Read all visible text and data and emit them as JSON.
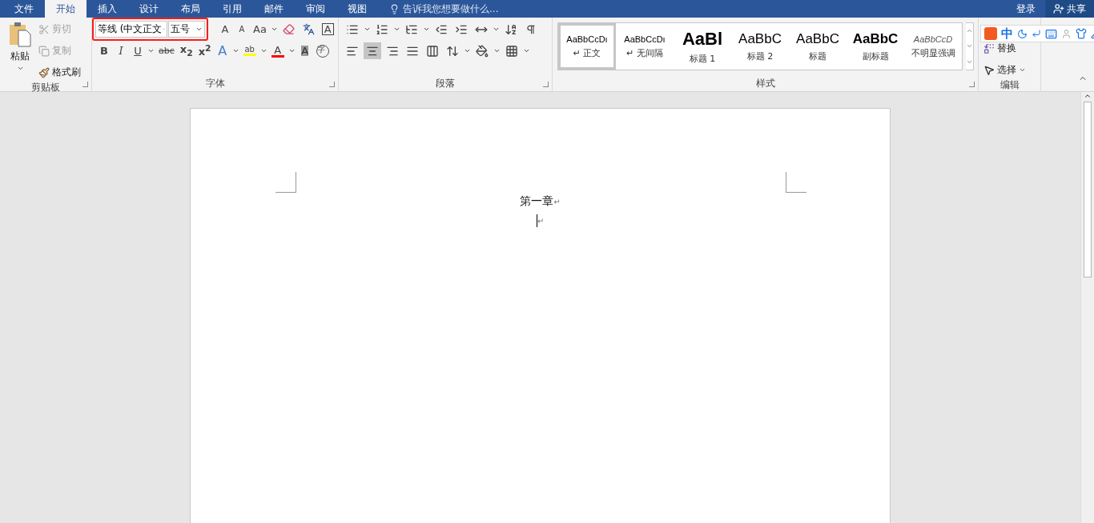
{
  "tabs": [
    {
      "label": "文件",
      "selected": false
    },
    {
      "label": "开始",
      "selected": true
    },
    {
      "label": "插入",
      "selected": false
    },
    {
      "label": "设计",
      "selected": false
    },
    {
      "label": "布局",
      "selected": false
    },
    {
      "label": "引用",
      "selected": false
    },
    {
      "label": "邮件",
      "selected": false
    },
    {
      "label": "审阅",
      "selected": false
    },
    {
      "label": "视图",
      "selected": false
    }
  ],
  "tell_me": {
    "placeholder": "告诉我您想要做什么..."
  },
  "account": {
    "sign_in": "登录",
    "share": "共享"
  },
  "clipboard": {
    "paste": "粘贴",
    "items": [
      {
        "label": "剪切",
        "kind": "cut",
        "disabled": true
      },
      {
        "label": "复制",
        "kind": "copy",
        "disabled": true
      },
      {
        "label": "格式刷",
        "kind": "painter",
        "disabled": false
      }
    ],
    "group_label": "剪贴板"
  },
  "font": {
    "name": "等线 (中文正文",
    "size": "五号",
    "highlighted": true,
    "group_label": "字体",
    "row1": [
      {
        "glyph": "A",
        "kind": "grow"
      },
      {
        "glyph": "A",
        "kind": "shrink"
      },
      {
        "glyph": "Aa",
        "kind": "case"
      },
      {
        "kind": "clear"
      },
      {
        "kind": "phonetic"
      },
      {
        "glyph": "A",
        "kind": "border"
      }
    ],
    "row2": [
      {
        "glyph": "B",
        "kind": "bold"
      },
      {
        "glyph": "I",
        "kind": "italic"
      },
      {
        "glyph": "U",
        "kind": "underline"
      },
      {
        "glyph": "abc",
        "kind": "strike"
      },
      {
        "glyph": "x$_{2}$",
        "kind": "subscript"
      },
      {
        "glyph": "x$^{2}$",
        "kind": "superscript"
      },
      {
        "glyph": "A",
        "kind": "effects"
      },
      {
        "glyph": "ab",
        "kind": "highlight"
      },
      {
        "glyph": "A",
        "kind": "fontcolor"
      },
      {
        "glyph": "A",
        "kind": "shading"
      },
      {
        "glyph": "字",
        "kind": "enclosed"
      }
    ]
  },
  "paragraph": {
    "group_label": "段落",
    "alignment": [
      {
        "kind": "left",
        "selected": false
      },
      {
        "kind": "center",
        "selected": true
      },
      {
        "kind": "right",
        "selected": false
      },
      {
        "kind": "justify",
        "selected": false
      },
      {
        "kind": "distributed",
        "selected": false
      }
    ]
  },
  "styles": {
    "group_label": "样式",
    "items": [
      {
        "preview": "AaBbCcDı",
        "label": "↵ 正文",
        "kind": "normal",
        "selected": true
      },
      {
        "preview": "AaBbCcDı",
        "label": "↵ 无间隔",
        "kind": "normal",
        "selected": false
      },
      {
        "preview": "AaBl",
        "label": "标题 1",
        "kind": "heading1",
        "selected": false
      },
      {
        "preview": "AaBbC",
        "label": "标题 2",
        "kind": "heading2",
        "selected": false
      },
      {
        "preview": "AaBbC",
        "label": "标题",
        "kind": "title",
        "selected": false
      },
      {
        "preview": "AaBbC",
        "label": "副标题",
        "kind": "subtitle",
        "selected": false
      },
      {
        "preview": "AaBbCcD",
        "label": "不明显强调",
        "kind": "emphasis",
        "selected": false
      }
    ]
  },
  "editing": {
    "group_label": "编辑",
    "items": [
      {
        "label": "替换",
        "kind": "replace"
      },
      {
        "label": "选择",
        "kind": "select"
      }
    ]
  },
  "ime": {
    "mode": "中"
  },
  "document": {
    "lines": [
      {
        "text": "第一章",
        "mark": "↵"
      },
      {
        "mark": "↵",
        "cursor": true
      }
    ]
  }
}
